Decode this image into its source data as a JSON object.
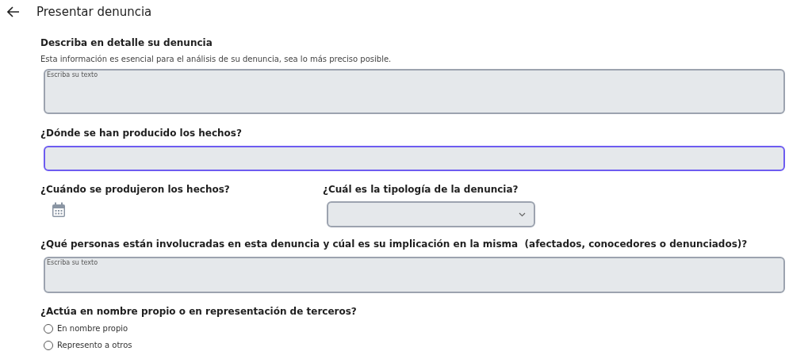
{
  "header": {
    "title": "Presentar denuncia"
  },
  "description": {
    "label": "Describa en detalle su denuncia",
    "hint": "Esta información es esencial para el análisis de su denuncia, sea lo más preciso posible.",
    "placeholder": "Escriba su texto"
  },
  "location": {
    "label": "¿Dónde se han producido los hechos?",
    "focused": true
  },
  "date": {
    "label": "¿Cuándo se produjeron los hechos?"
  },
  "type": {
    "label": "¿Cuál es la tipología de la denuncia?"
  },
  "people": {
    "label": "¿Qué personas están involucradas en esta denuncia y cúal es su implicación en la misma  (afectados, conocedores o denunciados)?",
    "placeholder": "Escriba su texto"
  },
  "representation": {
    "label": "¿Actúa en nombre propio o en representación de terceros?",
    "options": [
      {
        "label": "En nombre propio",
        "selected": false
      },
      {
        "label": "Represento a otros",
        "selected": false
      }
    ]
  }
}
